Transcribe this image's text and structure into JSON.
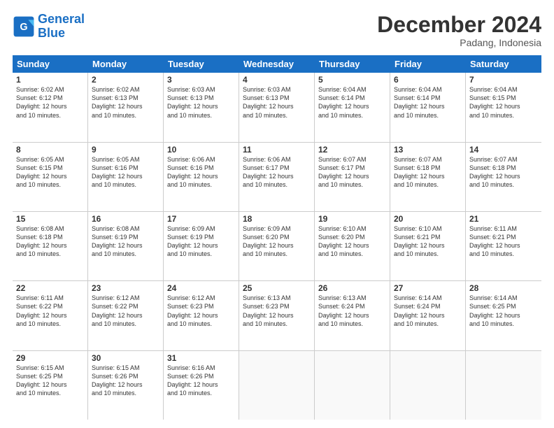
{
  "logo": {
    "line1": "General",
    "line2": "Blue"
  },
  "title": "December 2024",
  "location": "Padang, Indonesia",
  "days_header": [
    "Sunday",
    "Monday",
    "Tuesday",
    "Wednesday",
    "Thursday",
    "Friday",
    "Saturday"
  ],
  "weeks": [
    [
      {
        "day": "1",
        "info": "Sunrise: 6:02 AM\nSunset: 6:12 PM\nDaylight: 12 hours\nand 10 minutes."
      },
      {
        "day": "2",
        "info": "Sunrise: 6:02 AM\nSunset: 6:13 PM\nDaylight: 12 hours\nand 10 minutes."
      },
      {
        "day": "3",
        "info": "Sunrise: 6:03 AM\nSunset: 6:13 PM\nDaylight: 12 hours\nand 10 minutes."
      },
      {
        "day": "4",
        "info": "Sunrise: 6:03 AM\nSunset: 6:13 PM\nDaylight: 12 hours\nand 10 minutes."
      },
      {
        "day": "5",
        "info": "Sunrise: 6:04 AM\nSunset: 6:14 PM\nDaylight: 12 hours\nand 10 minutes."
      },
      {
        "day": "6",
        "info": "Sunrise: 6:04 AM\nSunset: 6:14 PM\nDaylight: 12 hours\nand 10 minutes."
      },
      {
        "day": "7",
        "info": "Sunrise: 6:04 AM\nSunset: 6:15 PM\nDaylight: 12 hours\nand 10 minutes."
      }
    ],
    [
      {
        "day": "8",
        "info": "Sunrise: 6:05 AM\nSunset: 6:15 PM\nDaylight: 12 hours\nand 10 minutes."
      },
      {
        "day": "9",
        "info": "Sunrise: 6:05 AM\nSunset: 6:16 PM\nDaylight: 12 hours\nand 10 minutes."
      },
      {
        "day": "10",
        "info": "Sunrise: 6:06 AM\nSunset: 6:16 PM\nDaylight: 12 hours\nand 10 minutes."
      },
      {
        "day": "11",
        "info": "Sunrise: 6:06 AM\nSunset: 6:17 PM\nDaylight: 12 hours\nand 10 minutes."
      },
      {
        "day": "12",
        "info": "Sunrise: 6:07 AM\nSunset: 6:17 PM\nDaylight: 12 hours\nand 10 minutes."
      },
      {
        "day": "13",
        "info": "Sunrise: 6:07 AM\nSunset: 6:18 PM\nDaylight: 12 hours\nand 10 minutes."
      },
      {
        "day": "14",
        "info": "Sunrise: 6:07 AM\nSunset: 6:18 PM\nDaylight: 12 hours\nand 10 minutes."
      }
    ],
    [
      {
        "day": "15",
        "info": "Sunrise: 6:08 AM\nSunset: 6:18 PM\nDaylight: 12 hours\nand 10 minutes."
      },
      {
        "day": "16",
        "info": "Sunrise: 6:08 AM\nSunset: 6:19 PM\nDaylight: 12 hours\nand 10 minutes."
      },
      {
        "day": "17",
        "info": "Sunrise: 6:09 AM\nSunset: 6:19 PM\nDaylight: 12 hours\nand 10 minutes."
      },
      {
        "day": "18",
        "info": "Sunrise: 6:09 AM\nSunset: 6:20 PM\nDaylight: 12 hours\nand 10 minutes."
      },
      {
        "day": "19",
        "info": "Sunrise: 6:10 AM\nSunset: 6:20 PM\nDaylight: 12 hours\nand 10 minutes."
      },
      {
        "day": "20",
        "info": "Sunrise: 6:10 AM\nSunset: 6:21 PM\nDaylight: 12 hours\nand 10 minutes."
      },
      {
        "day": "21",
        "info": "Sunrise: 6:11 AM\nSunset: 6:21 PM\nDaylight: 12 hours\nand 10 minutes."
      }
    ],
    [
      {
        "day": "22",
        "info": "Sunrise: 6:11 AM\nSunset: 6:22 PM\nDaylight: 12 hours\nand 10 minutes."
      },
      {
        "day": "23",
        "info": "Sunrise: 6:12 AM\nSunset: 6:22 PM\nDaylight: 12 hours\nand 10 minutes."
      },
      {
        "day": "24",
        "info": "Sunrise: 6:12 AM\nSunset: 6:23 PM\nDaylight: 12 hours\nand 10 minutes."
      },
      {
        "day": "25",
        "info": "Sunrise: 6:13 AM\nSunset: 6:23 PM\nDaylight: 12 hours\nand 10 minutes."
      },
      {
        "day": "26",
        "info": "Sunrise: 6:13 AM\nSunset: 6:24 PM\nDaylight: 12 hours\nand 10 minutes."
      },
      {
        "day": "27",
        "info": "Sunrise: 6:14 AM\nSunset: 6:24 PM\nDaylight: 12 hours\nand 10 minutes."
      },
      {
        "day": "28",
        "info": "Sunrise: 6:14 AM\nSunset: 6:25 PM\nDaylight: 12 hours\nand 10 minutes."
      }
    ],
    [
      {
        "day": "29",
        "info": "Sunrise: 6:15 AM\nSunset: 6:25 PM\nDaylight: 12 hours\nand 10 minutes."
      },
      {
        "day": "30",
        "info": "Sunrise: 6:15 AM\nSunset: 6:26 PM\nDaylight: 12 hours\nand 10 minutes."
      },
      {
        "day": "31",
        "info": "Sunrise: 6:16 AM\nSunset: 6:26 PM\nDaylight: 12 hours\nand 10 minutes."
      },
      {
        "day": "",
        "info": ""
      },
      {
        "day": "",
        "info": ""
      },
      {
        "day": "",
        "info": ""
      },
      {
        "day": "",
        "info": ""
      }
    ]
  ]
}
